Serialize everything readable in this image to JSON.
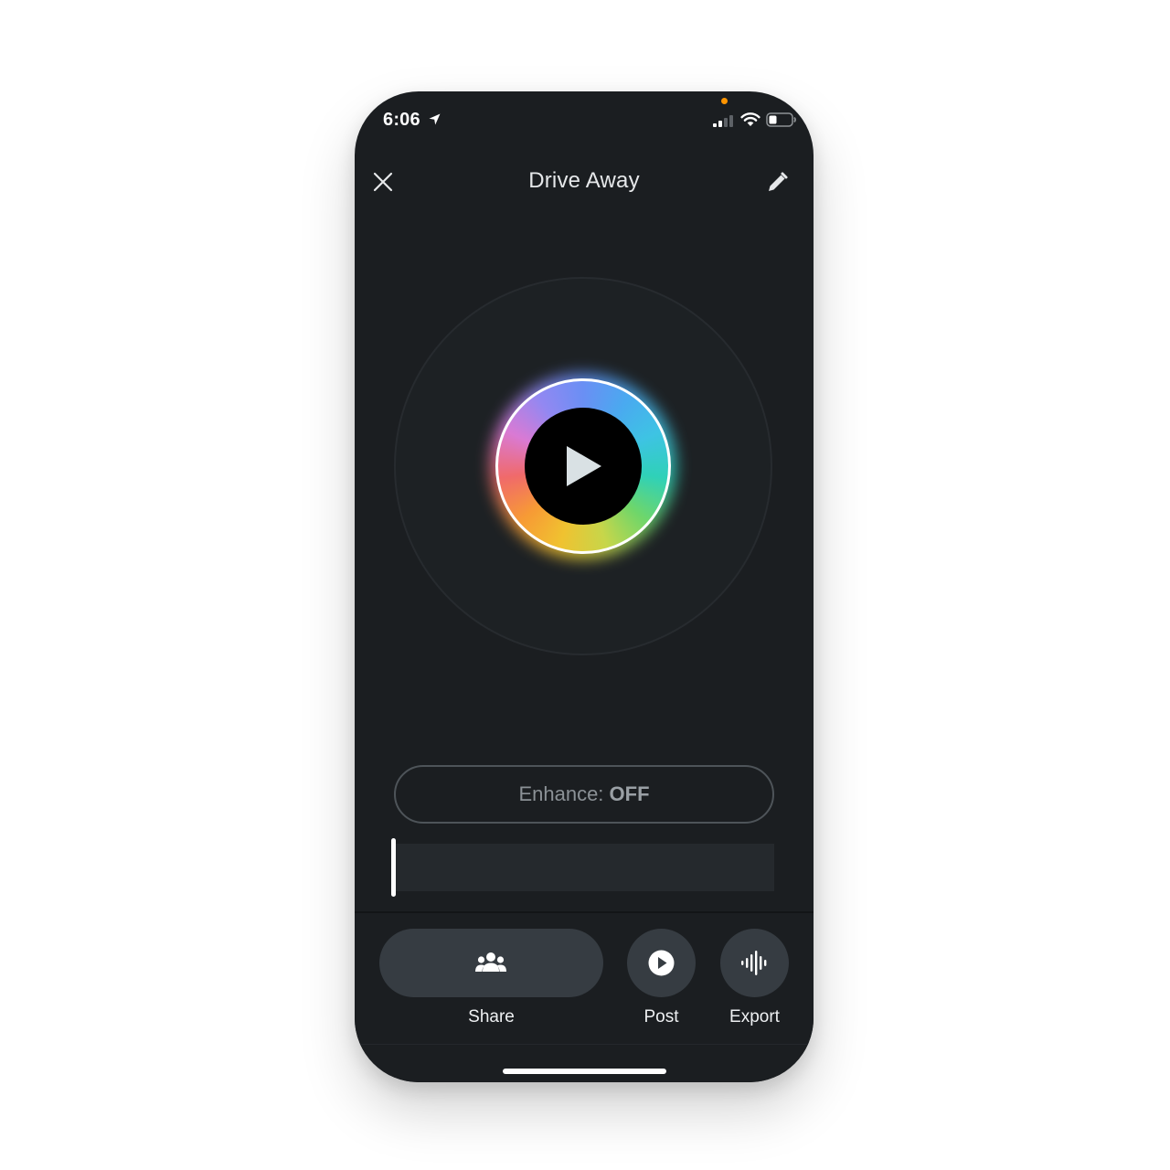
{
  "status_bar": {
    "time": "6:06",
    "location_icon": "location-arrow-icon",
    "signal_icon": "cellular-signal-icon",
    "wifi_icon": "wifi-icon",
    "battery_icon": "battery-icon"
  },
  "header": {
    "close_icon": "close-icon",
    "title": "Drive Away",
    "edit_icon": "pencil-icon"
  },
  "player": {
    "play_icon": "play-icon"
  },
  "enhance": {
    "label": "Enhance: ",
    "value": "OFF"
  },
  "actions": {
    "share_label": "Share",
    "share_icon": "people-group-icon",
    "post_label": "Post",
    "post_icon": "play-circle-icon",
    "export_label": "Export",
    "export_icon": "waveform-icon"
  },
  "colors": {
    "background": "#1b1e21",
    "button": "#363c42",
    "accent_text": "#ffffff",
    "notice_dot": "#ff9500"
  }
}
